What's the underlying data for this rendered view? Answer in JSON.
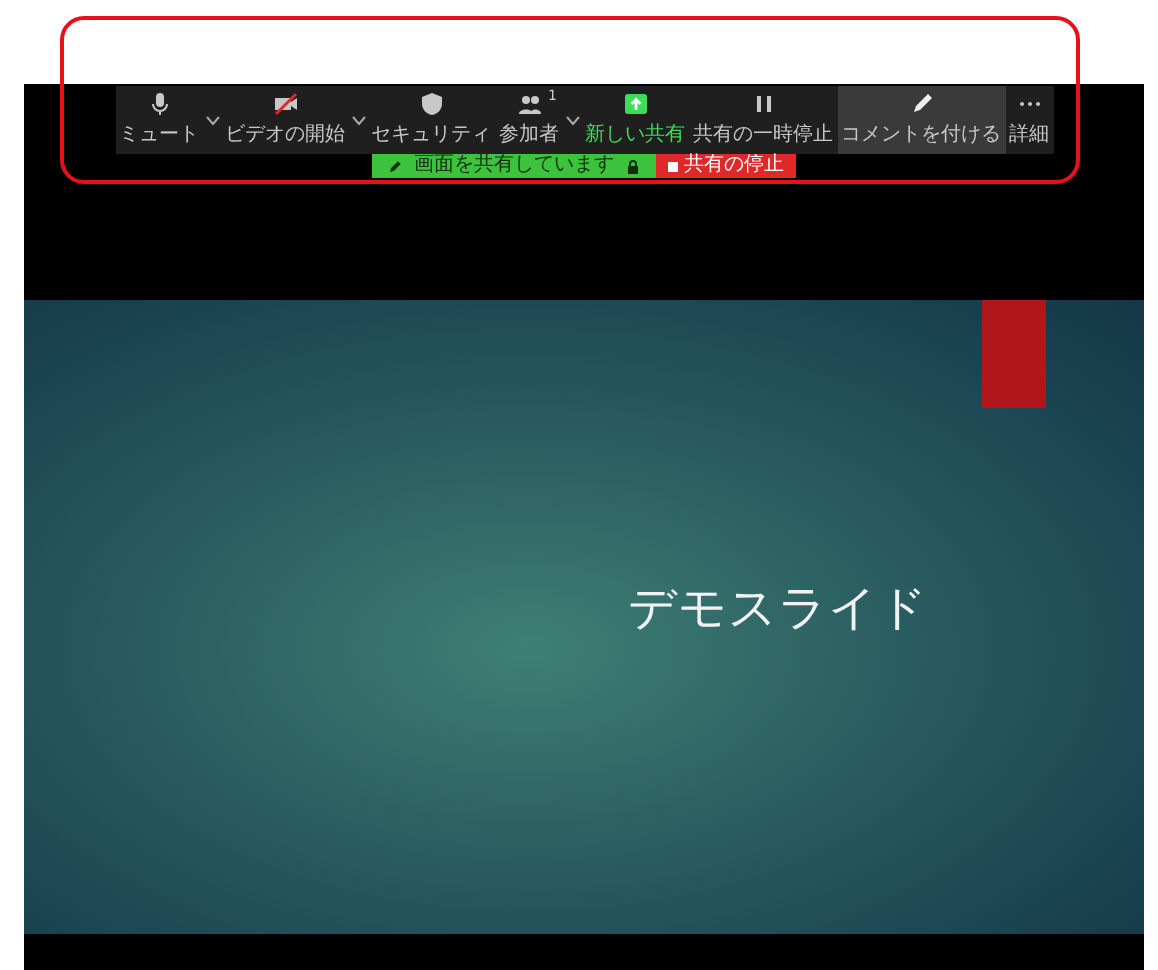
{
  "toolbar": {
    "items": [
      {
        "kind": "button",
        "label": "ミュート",
        "caret": true,
        "selected": false
      },
      {
        "kind": "button",
        "label": "ビデオの開始",
        "caret": true,
        "selected": false
      },
      {
        "kind": "button",
        "label": "セキュリティ",
        "caret": false,
        "selected": false
      },
      {
        "kind": "button",
        "label": "参加者",
        "badge": "1",
        "caret": true,
        "selected": false
      },
      {
        "kind": "share",
        "label": "新しい共有",
        "caret": false,
        "selected": false
      },
      {
        "kind": "button",
        "label": "共有の一時停止",
        "caret": false,
        "selected": false
      },
      {
        "kind": "button",
        "label": "コメントを付ける",
        "caret": false,
        "selected": true
      },
      {
        "kind": "button",
        "label": "詳細",
        "caret": false,
        "selected": false
      }
    ]
  },
  "share_bar": {
    "status": "画面を共有しています",
    "stop": "共有の停止"
  },
  "slide": {
    "title": "デモスライド"
  }
}
